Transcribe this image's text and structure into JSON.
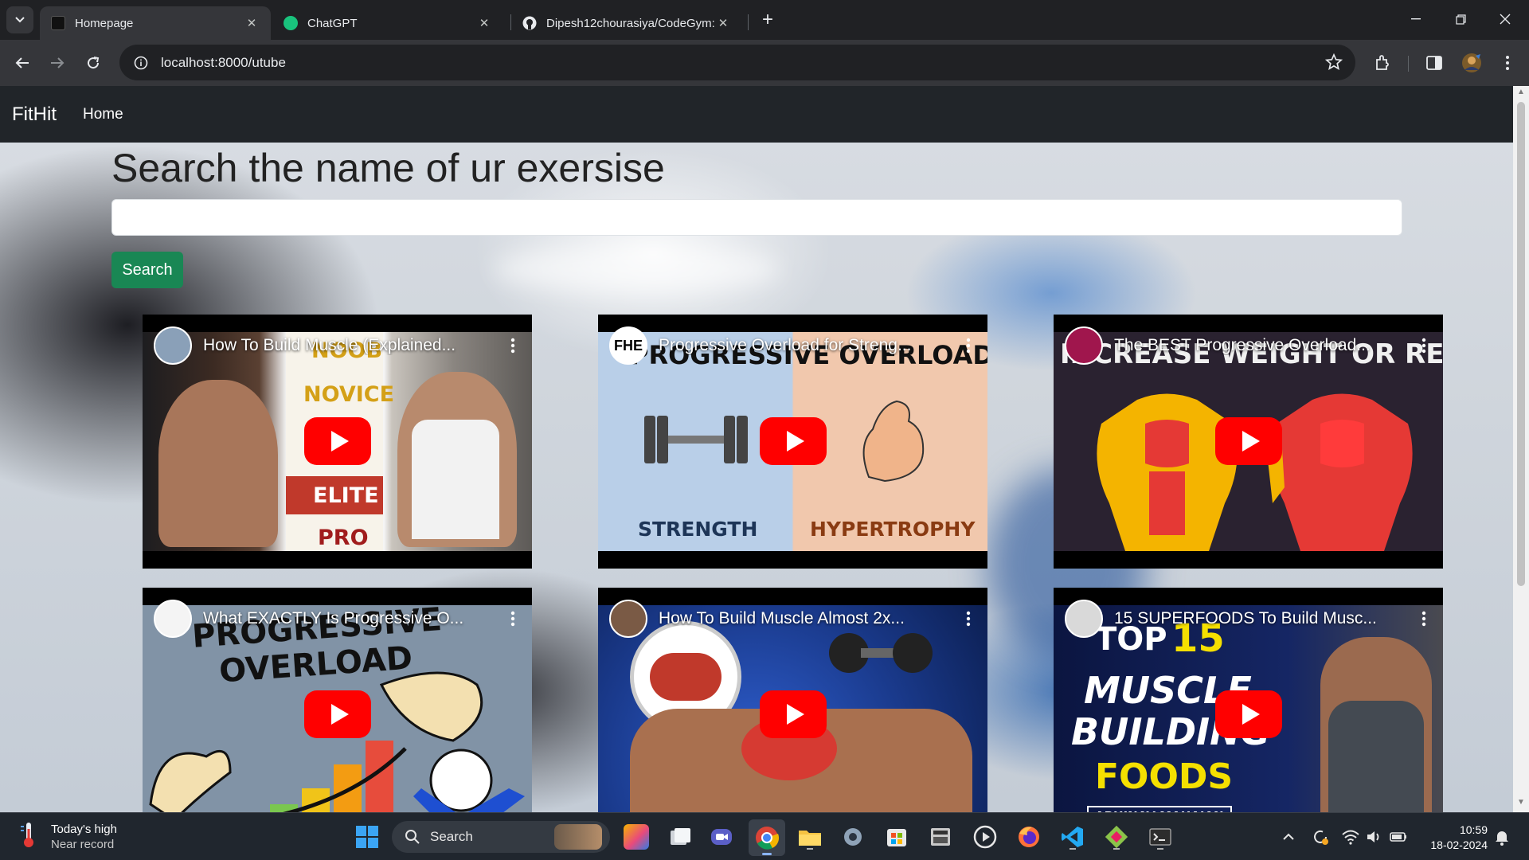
{
  "browser": {
    "tabs": [
      {
        "title": "Homepage",
        "active": true
      },
      {
        "title": "ChatGPT",
        "active": false
      },
      {
        "title": "Dipesh12chourasiya/CodeGym:",
        "active": false
      }
    ],
    "address": "localhost:8000/utube",
    "icons": [
      "tab-search-icon",
      "close-icon",
      "new-tab-icon",
      "minimize-icon",
      "restore-icon",
      "window-close-icon",
      "back-icon",
      "forward-icon",
      "reload-icon",
      "site-info-icon",
      "bookmark-star-icon",
      "extensions-icon",
      "side-panel-icon",
      "profile-avatar",
      "menu-dots-icon"
    ]
  },
  "page": {
    "navbar": {
      "brand": "FitHit",
      "home": "Home"
    },
    "heading": "Search the name of ur exersise",
    "search_value": "",
    "search_button": "Search",
    "colors": {
      "navbar": "#212529",
      "search_button": "#198754",
      "play_button": "#ff0000"
    },
    "videos": [
      {
        "title": "How To Build Muscle (Explained...",
        "thumb_text": [
          "NOOB",
          "NOVICE",
          "ELITE",
          "PRO"
        ]
      },
      {
        "title": "Progressive Overload for Streng...",
        "channel_badge": "FHE",
        "thumb_text": [
          "PROGRESSIVE OVERLOAD",
          "STRENGTH",
          "HYPERTROPHY"
        ]
      },
      {
        "title": "The BEST Progressive Overload...",
        "thumb_text": [
          "INCREASE WEIGHT OR REPS?"
        ]
      },
      {
        "title": "What EXACTLY Is Progressive O...",
        "thumb_text": [
          "PROGRESSIVE",
          "OVERLOAD"
        ]
      },
      {
        "title": "How To Build Muscle Almost 2x...",
        "thumb_text": []
      },
      {
        "title": "15 SUPERFOODS To Build Musc...",
        "thumb_text": [
          "TOP",
          "15",
          "MUSCLE",
          "BUILDING",
          "FOODS",
          "ABHINAV MAHAJAN"
        ]
      }
    ]
  },
  "taskbar": {
    "weather_line1": "Today's high",
    "weather_line2": "Near record",
    "search_label": "Search",
    "time": "10:59",
    "date": "18-02-2024",
    "app_icons": [
      "windows-start-icon",
      "widgets-icon",
      "task-view-icon",
      "teams-icon",
      "chrome-icon",
      "file-explorer-icon",
      "settings-icon",
      "store-icon",
      "calculator-icon",
      "media-player-icon",
      "firefox-icon",
      "vscode-icon",
      "git-icon",
      "terminal-icon"
    ]
  }
}
